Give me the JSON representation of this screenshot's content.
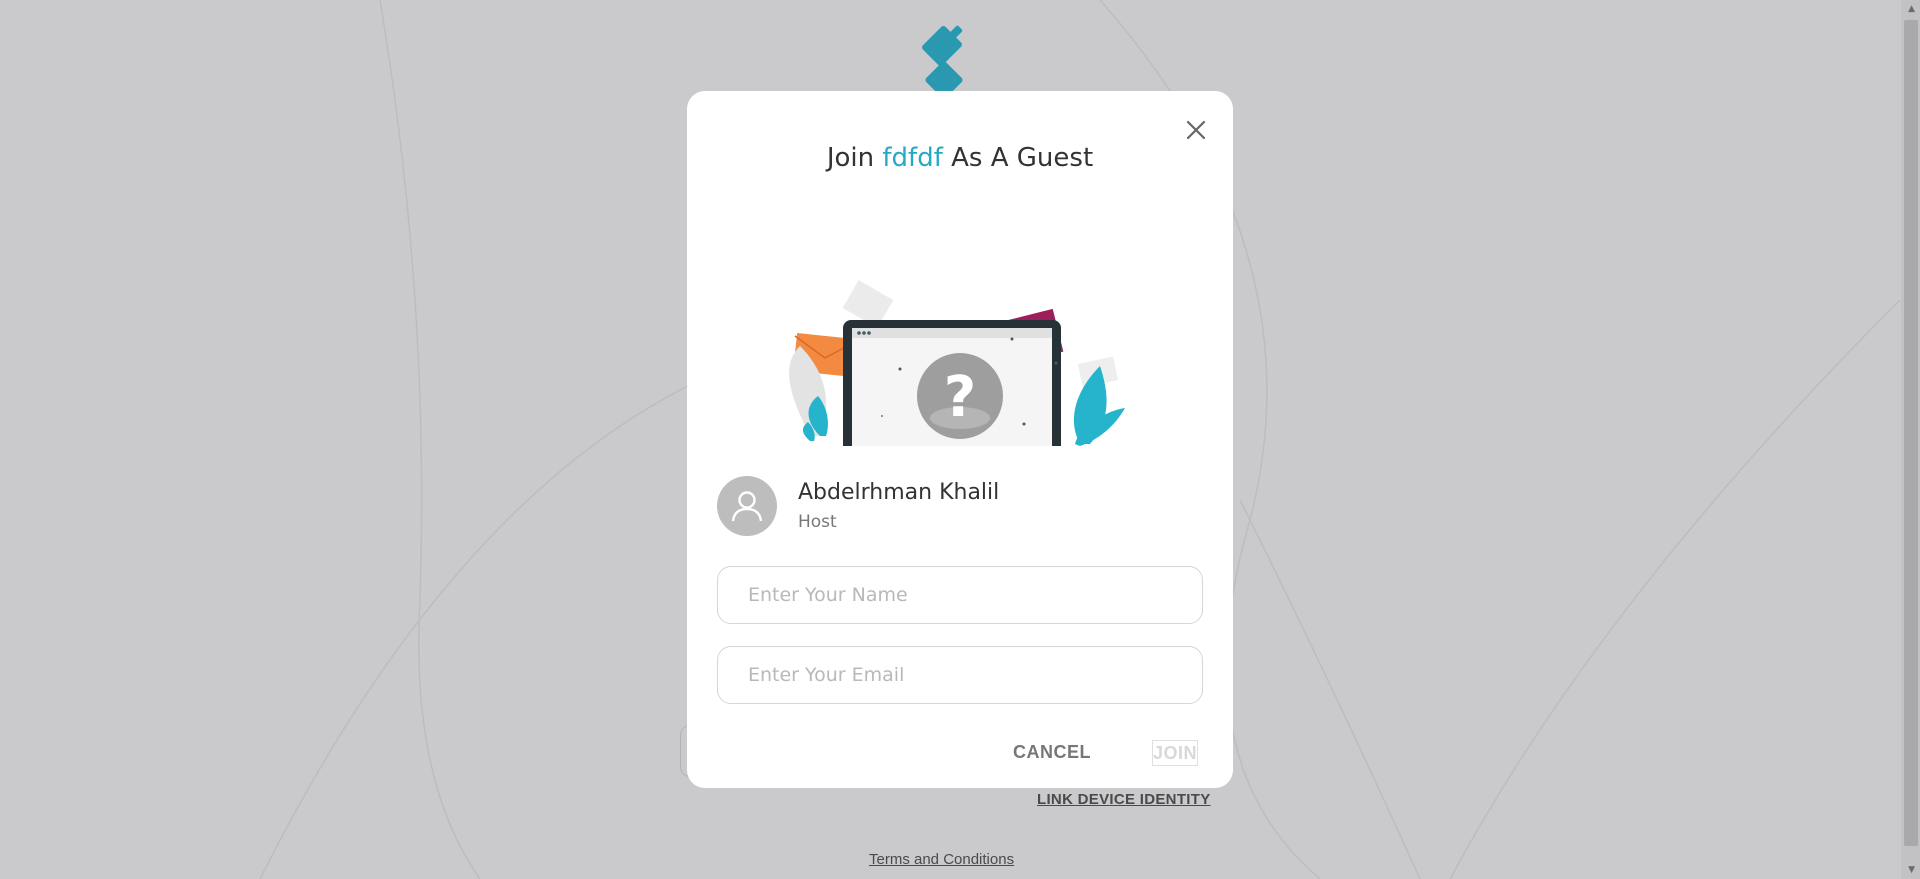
{
  "modal": {
    "title_prefix": "Join ",
    "room_name": "fdfdf",
    "title_suffix": " As A Guest",
    "host": {
      "name": "Abdelrhman Khalil",
      "role": "Host"
    },
    "name_field": {
      "placeholder": "Enter Your Name",
      "value": ""
    },
    "email_field": {
      "placeholder": "Enter Your Email",
      "value": ""
    },
    "cancel_label": "CANCEL",
    "join_label": "JOIN"
  },
  "background": {
    "link_device_label": "LINK DEVICE IDENTITY",
    "terms_label": "Terms and Conditions"
  },
  "colors": {
    "accent": "#26a9c4",
    "overlay_background": "#cacacc",
    "join_disabled": "#d8d8d8"
  },
  "icons": {
    "close": "close-icon",
    "avatar": "user-icon",
    "logo": "app-logo",
    "illustration": "laptop-question-illustration"
  }
}
